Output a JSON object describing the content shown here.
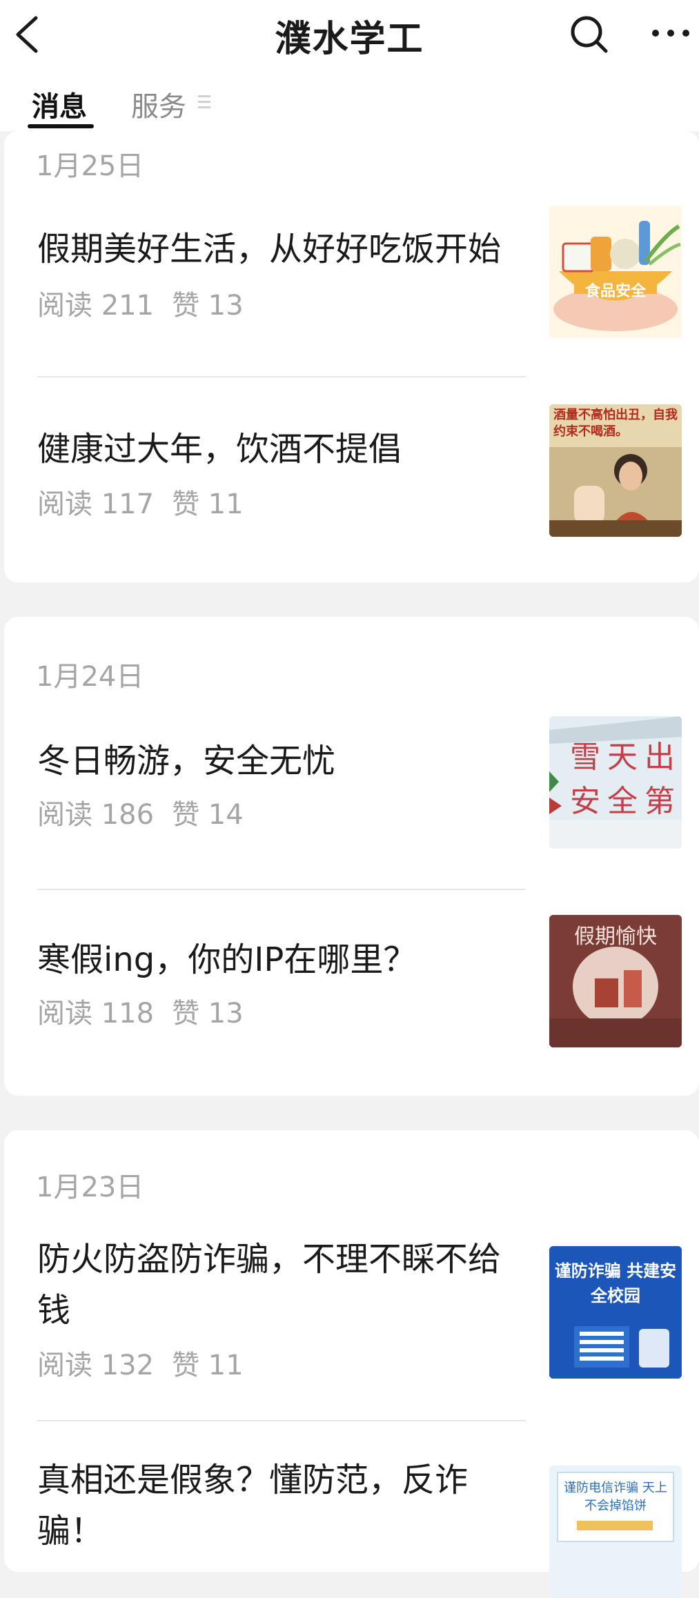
{
  "header": {
    "title": "濮水学工"
  },
  "tabs": {
    "messages": "消息",
    "services": "服务"
  },
  "groups": [
    {
      "date": "1月25日",
      "articles": [
        {
          "title": "假期美好生活，从好好吃饭开始",
          "reads": "阅读 211",
          "likes": "赞 13",
          "thumb_text": "食品安全"
        },
        {
          "title": "健康过大年，饮酒不提倡",
          "reads": "阅读 117",
          "likes": "赞 11",
          "thumb_text": "酒量不高怕出丑，自我约束不喝酒。"
        }
      ]
    },
    {
      "date": "1月24日",
      "articles": [
        {
          "title": "冬日畅游，安全无忧",
          "reads": "阅读 186",
          "likes": "赞 14",
          "thumb_text": "雪天出 安全第"
        },
        {
          "title": "寒假ing，你的IP在哪里？",
          "reads": "阅读 118",
          "likes": "赞 13",
          "thumb_text": "假期愉快"
        }
      ]
    },
    {
      "date": "1月23日",
      "articles": [
        {
          "title": "防火防盗防诈骗，不理不睬不给钱",
          "reads": "阅读 132",
          "likes": "赞 11",
          "thumb_text": "谨防诈骗 共建安全校园"
        },
        {
          "title": "真相还是假象？懂防范，反诈骗！",
          "reads": "",
          "likes": "",
          "thumb_text": "谨防电信诈骗 天上不会掉馅饼"
        }
      ]
    }
  ]
}
